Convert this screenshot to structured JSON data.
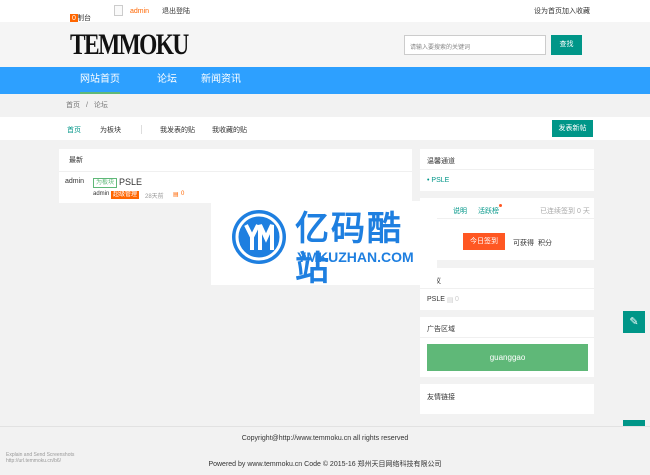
{
  "topbar": {
    "console_label": "控制台",
    "console_badge": "0",
    "username": "admin",
    "logout_label": "退出登陆",
    "set_home_label": "设为首页",
    "add_fav_label": "加入收藏"
  },
  "header": {
    "logo_text": "TEMMOKU",
    "search_placeholder": "请输入要搜索的关键词",
    "search_button": "查找"
  },
  "nav": {
    "items": [
      {
        "label": "网站首页",
        "active": true
      },
      {
        "label": "论坛",
        "active": false
      },
      {
        "label": "新闻资讯",
        "active": false
      }
    ]
  },
  "breadcrumb": {
    "home": "首页",
    "separator": "/",
    "current": "论坛"
  },
  "toolbar": {
    "tabs": [
      "首页",
      "为板块",
      "我发表的贴",
      "我收藏的贴"
    ],
    "post_button": "发表新帖"
  },
  "main": {
    "section_title": "最新",
    "posts": [
      {
        "author_top": "admin",
        "tag": "为板块",
        "title": "PSLE",
        "author": "admin",
        "role_badge": "超级管理",
        "time": "28天前",
        "replies": "0"
      }
    ]
  },
  "sidebar": {
    "hot_title": "温馨通道",
    "hot_items": [
      "PSLE"
    ],
    "sign": {
      "tabs": [
        "说明",
        "活跃榜"
      ],
      "consecutive_text": "已连续签到",
      "days": "0",
      "days_unit": "天",
      "button": "今日签到",
      "can_get": "可获得",
      "points": "积分"
    },
    "hot_topic_title": "热议",
    "hot_topic_items": [
      {
        "title": "PSLE",
        "count": "0"
      }
    ],
    "ad_title": "广告区域",
    "ad_text": "guanggao",
    "links_title": "友情链接"
  },
  "watermark": {
    "logo_text": "YM",
    "title": "亿码酷站",
    "subtitle": "YMKUZHAN.COM"
  },
  "footer": {
    "copyright": "Copyright@http://www.temmoku.cn all rights reserved",
    "powered": "Powered by www.temmoku.cn Code © 2015-16 郑州天目网络科技有限公司"
  },
  "corner_note": {
    "line1": "Explain and Send Screenshots",
    "line2": "http://url.temmoku.cn/b6/"
  },
  "colors": {
    "nav_bg": "#2da0ff",
    "primary": "#009688",
    "accent_orange": "#ff5722",
    "ad_green": "#5fb878",
    "watermark_blue": "#1e7fe0"
  }
}
